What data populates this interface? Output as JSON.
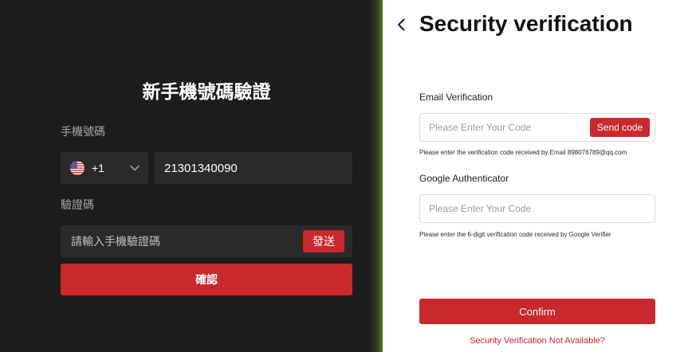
{
  "colors": {
    "left_bg": "#1c1c1c",
    "field_bg": "#2a2a2a",
    "accent_red": "#c9282d"
  },
  "icons": {
    "country_flag": "us-flag-icon",
    "country_dropdown": "chevron-down-icon",
    "back": "chevron-left-icon"
  },
  "phone_form": {
    "title": "新手機號碼驗證",
    "phone_label": "手機號碼",
    "country_code": "+1",
    "phone_number": "21301340090",
    "code_label": "驗證碼",
    "code_placeholder": "請輸入手機驗證碼",
    "send_button": "發送",
    "confirm_button": "確認"
  },
  "security_verification": {
    "title": "Security verification",
    "email": {
      "label": "Email Verification",
      "placeholder": "Please Enter Your Code",
      "send_button": "Send code",
      "help": "Please enter the verification code received by Email 898076789@qq.com"
    },
    "google": {
      "label": "Google Authenticator",
      "placeholder": "Please Enter Your Code",
      "help": "Please enter the 6-digit verification code received by Google Verifier"
    },
    "confirm_button": "Confirm",
    "unavailable_link": "Security Verification Not Available?"
  }
}
